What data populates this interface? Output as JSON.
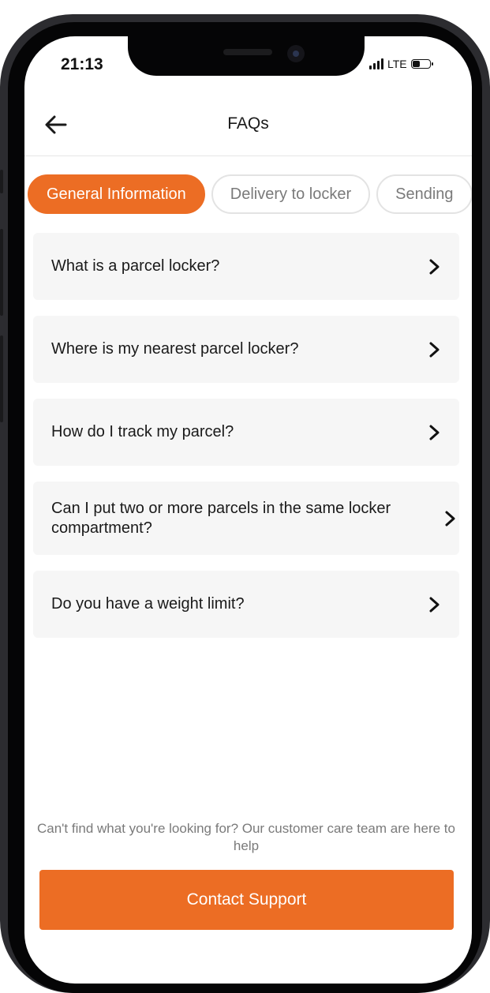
{
  "status_bar": {
    "time": "21:13",
    "network": "LTE",
    "battery_level": 0.45
  },
  "header": {
    "title": "FAQs",
    "back_icon": "arrow-left-icon"
  },
  "tabs": [
    {
      "label": "General Information",
      "active": true
    },
    {
      "label": "Delivery to locker",
      "active": false
    },
    {
      "label": "Sending",
      "active": false
    }
  ],
  "faqs": [
    {
      "question": "What is a parcel locker?"
    },
    {
      "question": "Where is my nearest parcel locker?"
    },
    {
      "question": "How do I track my parcel?"
    },
    {
      "question": "Can I put two or more parcels in the same locker compartment?"
    },
    {
      "question": "Do you have a weight limit?"
    }
  ],
  "footer": {
    "help_text": "Can't find what you're looking for? Our customer care team are here to help",
    "contact_label": "Contact Support"
  },
  "colors": {
    "accent": "#ec6d24",
    "card_bg": "#f6f6f6",
    "muted_text": "#7a7a7a"
  }
}
